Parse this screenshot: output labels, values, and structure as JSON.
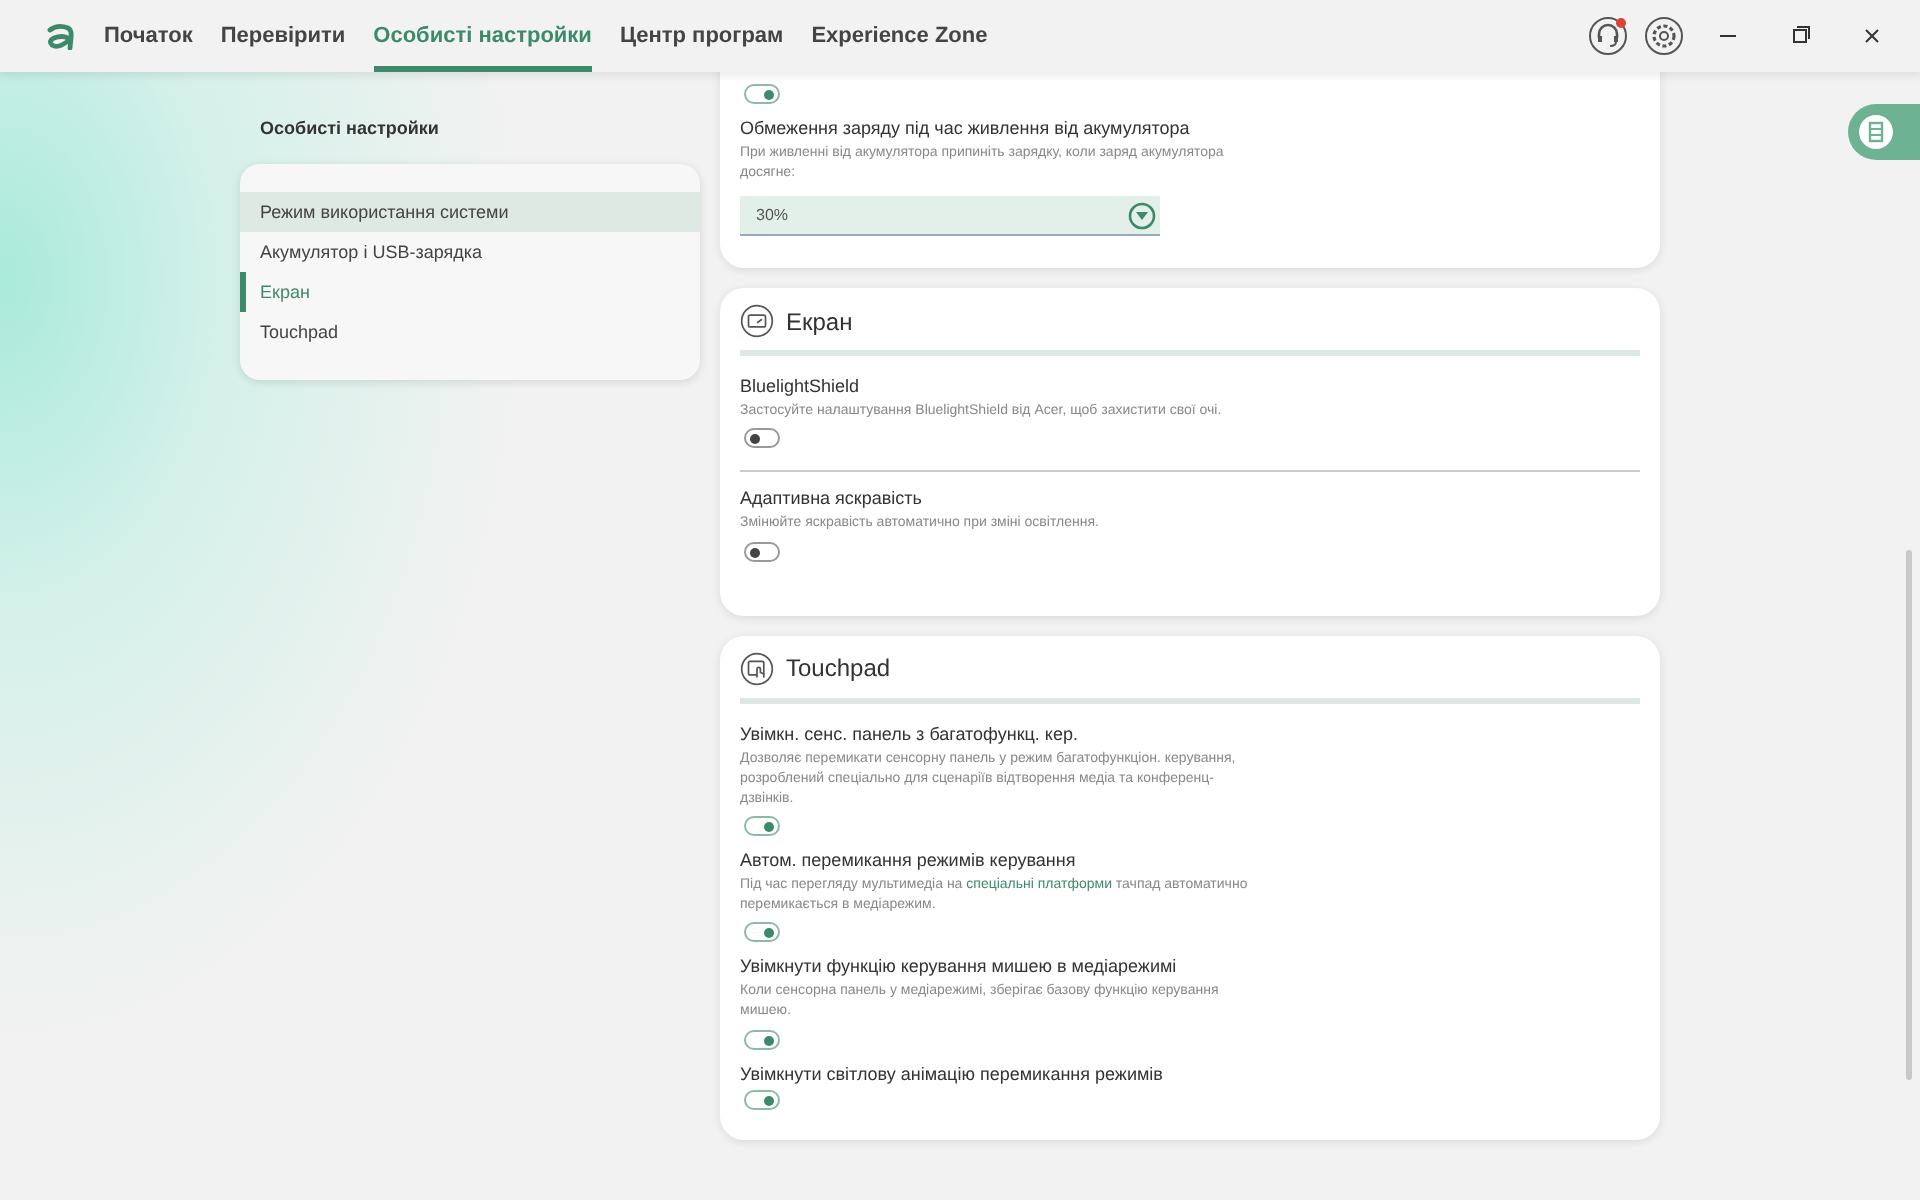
{
  "nav": {
    "tabs": [
      {
        "label": "Початок",
        "selected": false
      },
      {
        "label": "Перевірити",
        "selected": false
      },
      {
        "label": "Особисті настройки",
        "selected": true
      },
      {
        "label": "Центр програм",
        "selected": false
      },
      {
        "label": "Experience Zone",
        "selected": false
      }
    ],
    "support_badge": true
  },
  "sidebar": {
    "title": "Особисті настройки",
    "items": [
      {
        "label": "Режим використання системи",
        "highlighted": true,
        "selected": false
      },
      {
        "label": "Акумулятор і USB-зарядка",
        "highlighted": false,
        "selected": false
      },
      {
        "label": "Екран",
        "highlighted": false,
        "selected": true
      },
      {
        "label": "Touchpad",
        "highlighted": false,
        "selected": false
      }
    ]
  },
  "sections": [
    {
      "items": [
        {
          "kind": "toggle",
          "on": true
        },
        {
          "kind": "select",
          "label": "Обмеження заряду під час живлення від акумулятора",
          "description": [
            {
              "text": "При живленні від акумулятора припиніть зарядку, коли заряд акумулятора досягне:"
            }
          ],
          "value": "30%"
        }
      ]
    },
    {
      "title": "Екран",
      "dividers": true,
      "items": [
        {
          "kind": "toggle",
          "label": "BluelightShield",
          "description": [
            {
              "text": "Застосуйте налаштування BluelightShield від Acer, щоб захистити свої очі."
            }
          ],
          "on": false
        },
        {
          "kind": "toggle",
          "label": "Адаптивна яскравість",
          "description": [
            {
              "text": "Змінюйте яскравість автоматично при зміні освітлення."
            }
          ],
          "on": false
        }
      ]
    },
    {
      "title": "Touchpad",
      "dividers": false,
      "items": [
        {
          "kind": "toggle",
          "label": "Увімкн. сенс. панель з багатофункц. кер.",
          "description": [
            {
              "text": "Дозволяє перемикати сенсорну панель у режим багатофункціон. керування, розроблений спеціально для сценаріїв відтворення медіа та конференц-дзвінків."
            }
          ],
          "on": true
        },
        {
          "kind": "toggle",
          "label": "Автом. перемикання режимів керування",
          "description": [
            {
              "text": "Під час перегляду мультимедіа на "
            },
            {
              "text": "спеціальні платформи",
              "kind": "link"
            },
            {
              "text": " тачпад автоматично перемикається в медіарежим."
            }
          ],
          "on": true
        },
        {
          "kind": "toggle",
          "label": "Увімкнути функцію керування мишею в медіарежимі",
          "description": [
            {
              "text": "Коли сенсорна панель у медіарежимі, зберігає базову функцію керування мишею."
            }
          ],
          "on": true
        },
        {
          "kind": "toggle",
          "label": "Увімкнути світлову анімацію перемикання режимів",
          "on": true
        }
      ]
    }
  ]
}
